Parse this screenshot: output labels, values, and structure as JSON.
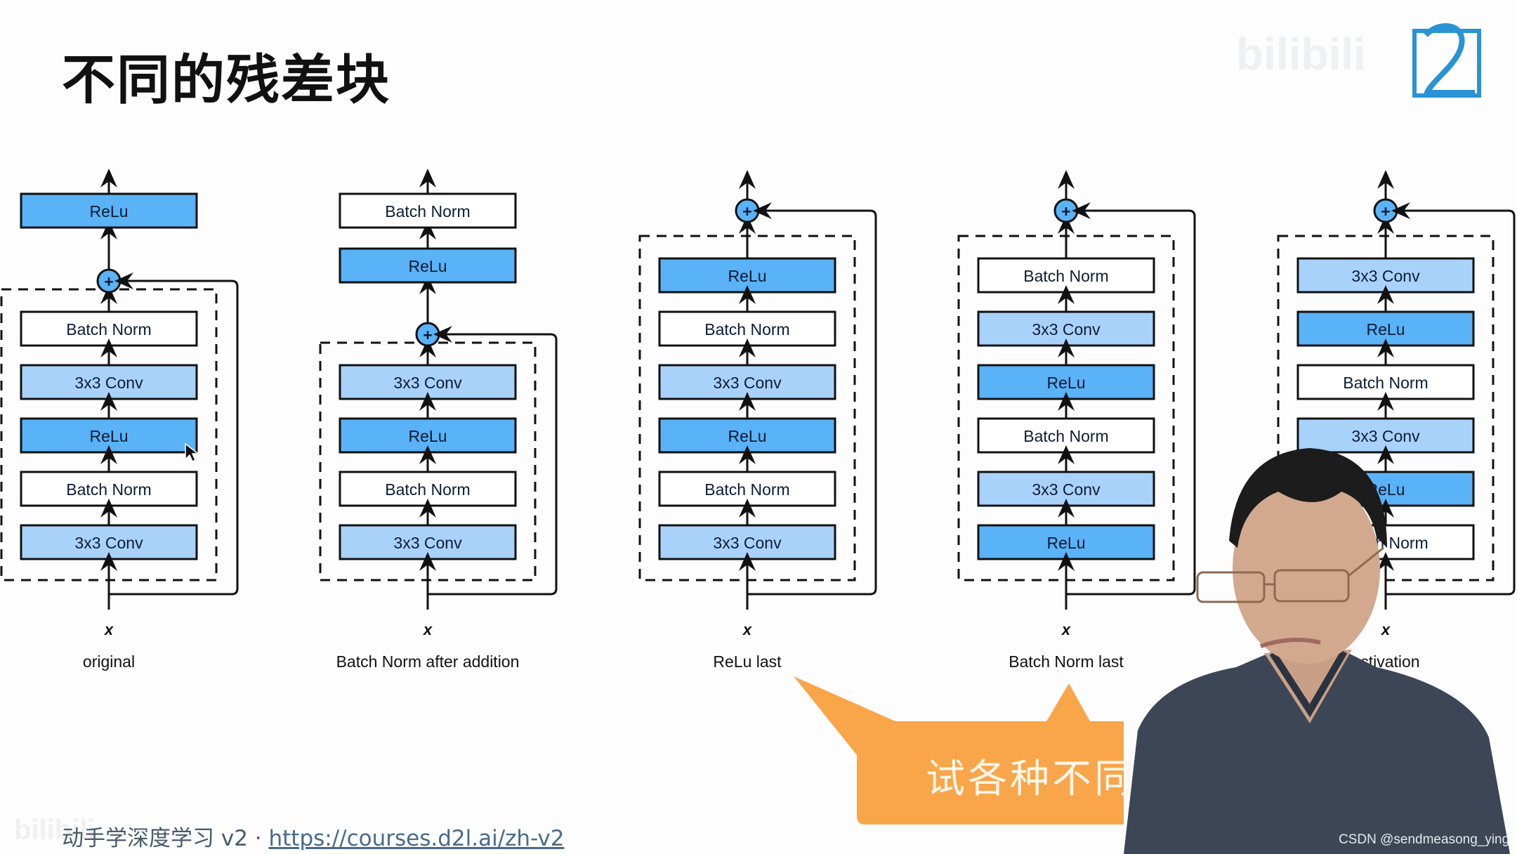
{
  "slide": {
    "title": "不同的残差块",
    "footer_text": "动手学深度学习 v2 · ",
    "footer_link": "https://courses.d2l.ai/zh-v2",
    "logo_icon": "d2l-logo-icon",
    "bilibili_ghost": "bilibili"
  },
  "colors": {
    "relu": "#5ab2f7",
    "conv": "#a9d2fb",
    "bn": "#ffffff",
    "plus": "#5ab2f7",
    "bubble": "#f9a54a"
  },
  "diagrams": [
    {
      "caption": "original",
      "input_label": "x",
      "plus_label": "+",
      "plus_position": "middle",
      "post_blocks": [
        {
          "label": "ReLu",
          "kind": "relu"
        }
      ],
      "inner_blocks_top_to_bottom": [
        {
          "label": "Batch Norm",
          "kind": "bn"
        },
        {
          "label": "3x3 Conv",
          "kind": "conv"
        },
        {
          "label": "ReLu",
          "kind": "relu"
        },
        {
          "label": "Batch Norm",
          "kind": "bn"
        },
        {
          "label": "3x3 Conv",
          "kind": "conv"
        }
      ]
    },
    {
      "caption": "Batch Norm after addition",
      "input_label": "x",
      "plus_label": "+",
      "plus_position": "middle",
      "post_blocks": [
        {
          "label": "ReLu",
          "kind": "relu"
        },
        {
          "label": "Batch Norm",
          "kind": "bn"
        }
      ],
      "inner_blocks_top_to_bottom": [
        {
          "label": "3x3 Conv",
          "kind": "conv"
        },
        {
          "label": "ReLu",
          "kind": "relu"
        },
        {
          "label": "Batch Norm",
          "kind": "bn"
        },
        {
          "label": "3x3 Conv",
          "kind": "conv"
        }
      ]
    },
    {
      "caption": "ReLu last",
      "input_label": "x",
      "plus_label": "+",
      "plus_position": "top",
      "post_blocks": [],
      "inner_blocks_top_to_bottom": [
        {
          "label": "ReLu",
          "kind": "relu"
        },
        {
          "label": "Batch Norm",
          "kind": "bn"
        },
        {
          "label": "3x3 Conv",
          "kind": "conv"
        },
        {
          "label": "ReLu",
          "kind": "relu"
        },
        {
          "label": "Batch Norm",
          "kind": "bn"
        },
        {
          "label": "3x3 Conv",
          "kind": "conv"
        }
      ]
    },
    {
      "caption": "Batch Norm last",
      "input_label": "x",
      "plus_label": "+",
      "plus_position": "top",
      "post_blocks": [],
      "inner_blocks_top_to_bottom": [
        {
          "label": "Batch Norm",
          "kind": "bn"
        },
        {
          "label": "3x3 Conv",
          "kind": "conv"
        },
        {
          "label": "ReLu",
          "kind": "relu"
        },
        {
          "label": "Batch Norm",
          "kind": "bn"
        },
        {
          "label": "3x3 Conv",
          "kind": "conv"
        },
        {
          "label": "ReLu",
          "kind": "relu"
        }
      ]
    },
    {
      "caption": "activation",
      "input_label": "x",
      "plus_label": "+",
      "plus_position": "top",
      "post_blocks": [],
      "inner_blocks_top_to_bottom": [
        {
          "label": "3x3 Conv",
          "kind": "conv"
        },
        {
          "label": "ReLu",
          "kind": "relu"
        },
        {
          "label": "Batch Norm",
          "kind": "bn"
        },
        {
          "label": "3x3 Conv",
          "kind": "conv"
        },
        {
          "label": "ReLu",
          "kind": "relu"
        },
        {
          "label": "Batch Norm",
          "kind": "bn"
        }
      ]
    }
  ],
  "overlay": {
    "bubble_text": "试各种不同",
    "watermark": "CSDN @sendmeasong_ying",
    "presenter": "presenter-video"
  }
}
